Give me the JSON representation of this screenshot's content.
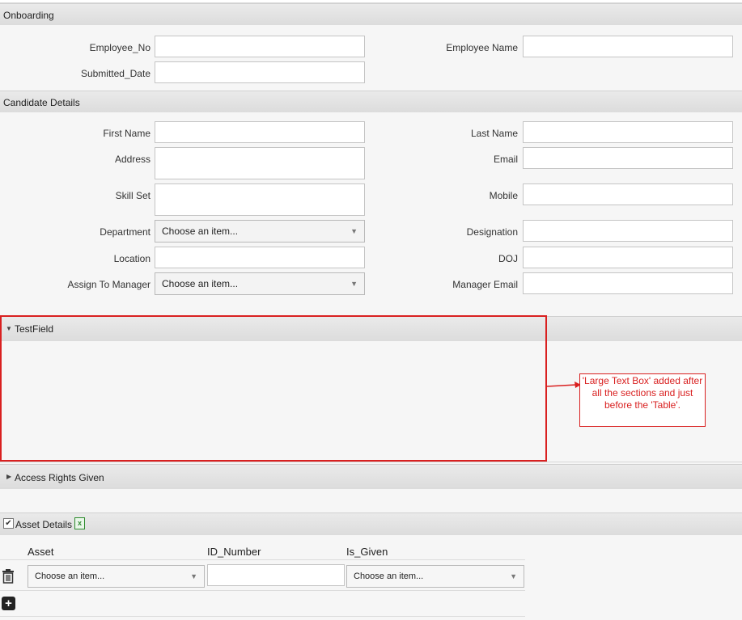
{
  "onboarding": {
    "title": "Onboarding",
    "employee_no_label": "Employee_No",
    "employee_name_label": "Employee Name",
    "submitted_date_label": "Submitted_Date"
  },
  "candidate": {
    "title": "Candidate Details",
    "first_name_label": "First Name",
    "last_name_label": "Last Name",
    "address_label": "Address",
    "email_label": "Email",
    "skill_set_label": "Skill Set",
    "mobile_label": "Mobile",
    "department_label": "Department",
    "department_value": "Choose an item...",
    "designation_label": "Designation",
    "location_label": "Location",
    "doj_label": "DOJ",
    "manager_label": "Assign To Manager",
    "manager_value": "Choose an item...",
    "manager_email_label": "Manager Email"
  },
  "testfield": {
    "title": "TestField"
  },
  "annotation": {
    "text": "'Large Text Box' added after all the sections and just before the 'Table'.",
    "color": "#d92020"
  },
  "access": {
    "title": "Access Rights Given"
  },
  "asset": {
    "title": "Asset Details",
    "columns": [
      "Asset",
      "ID_Number",
      "Is_Given"
    ],
    "row": {
      "asset_value": "Choose an item...",
      "is_given_value": "Choose an item..."
    }
  },
  "icons": [
    "triangle-down-icon",
    "triangle-right-icon",
    "checkbox-icon",
    "excel-icon",
    "trash-icon",
    "add-icon",
    "chevron-down-icon"
  ]
}
